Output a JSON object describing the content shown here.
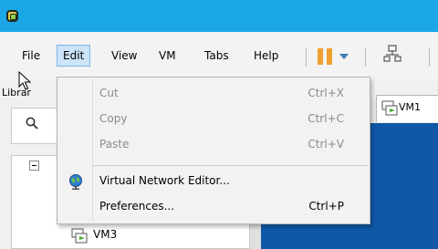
{
  "menubar": {
    "items": [
      "File",
      "Edit",
      "View",
      "VM",
      "Tabs",
      "Help"
    ],
    "active": "Edit"
  },
  "library": {
    "label": "Librar"
  },
  "tree": {
    "vm_label": "VM3"
  },
  "tab": {
    "label": "VM1"
  },
  "edit_menu": {
    "items": [
      {
        "label": "Cut",
        "shortcut": "Ctrl+X",
        "enabled": false
      },
      {
        "label": "Copy",
        "shortcut": "Ctrl+C",
        "enabled": false
      },
      {
        "label": "Paste",
        "shortcut": "Ctrl+V",
        "enabled": false
      },
      {
        "label": "Virtual Network Editor...",
        "shortcut": "",
        "enabled": true,
        "icon": "globe-icon"
      },
      {
        "label": "Preferences...",
        "shortcut": "Ctrl+P",
        "enabled": true
      }
    ]
  },
  "colors": {
    "titlebar": "#1ba7e6",
    "menu_highlight": "#cce4f7",
    "vm_background": "#0e58a6"
  }
}
